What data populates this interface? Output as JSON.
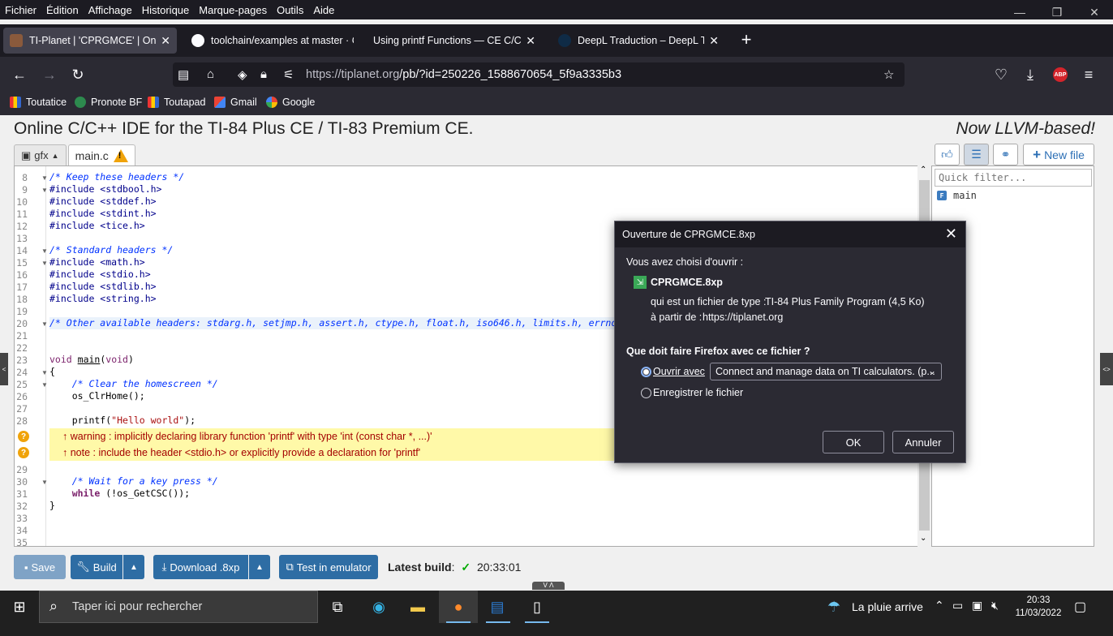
{
  "menu": [
    "Fichier",
    "Édition",
    "Affichage",
    "Historique",
    "Marque-pages",
    "Outils",
    "Aide"
  ],
  "window_controls": {
    "minimize": "—",
    "restore": "❐",
    "close": "✕"
  },
  "tabs": [
    {
      "title": "TI-Planet | 'CPRGMCE' | Online ID",
      "icon": "tiplanet-icon",
      "active": true
    },
    {
      "title": "toolchain/examples at master · C",
      "icon": "github-icon",
      "active": false
    },
    {
      "title": "Using printf Functions — CE C/C++",
      "icon": "",
      "active": false
    },
    {
      "title": "DeepL Traduction – DeepL Transl",
      "icon": "deepl-icon",
      "active": false
    }
  ],
  "new_tab": "+",
  "url": {
    "host": "https://tiplanet.org",
    "path": "/pb/?id=250226_1588670654_5f9a3335b3"
  },
  "bookmarks": [
    {
      "label": "Toutatice",
      "icon": "toutatice-icon"
    },
    {
      "label": "Pronote BF",
      "icon": "pronote-icon"
    },
    {
      "label": "Toutapad",
      "icon": "toutapad-icon"
    },
    {
      "label": "Gmail",
      "icon": "gmail-icon"
    },
    {
      "label": "Google",
      "icon": "google-icon"
    }
  ],
  "abp_badge": "ABP",
  "page": {
    "title": "Online C/C++ IDE for the TI-84 Plus CE / TI-83 Premium CE.",
    "tagline": "Now LLVM-based!",
    "gfx_tab": "gfx",
    "file_tab": "main.c",
    "new_file": "New file",
    "quick_filter_placeholder": "Quick filter...",
    "side_file": "main",
    "side_file_badge": "F"
  },
  "code": {
    "lines": [
      {
        "n": "8",
        "fold": true,
        "text": "/* Keep these headers */",
        "cls": "cmt"
      },
      {
        "n": "9",
        "fold": true,
        "text": "#include <stdbool.h>",
        "cls": "pp"
      },
      {
        "n": "10",
        "text": "#include <stddef.h>",
        "cls": "pp"
      },
      {
        "n": "11",
        "text": "#include <stdint.h>",
        "cls": "pp"
      },
      {
        "n": "12",
        "text": "#include <tice.h>",
        "cls": "pp"
      },
      {
        "n": "13",
        "text": "",
        "cls": ""
      },
      {
        "n": "14",
        "fold": true,
        "text": "/* Standard headers */",
        "cls": "cmt"
      },
      {
        "n": "15",
        "fold": true,
        "text": "#include <math.h>",
        "cls": "pp"
      },
      {
        "n": "16",
        "text": "#include <stdio.h>",
        "cls": "pp"
      },
      {
        "n": "17",
        "text": "#include <stdlib.h>",
        "cls": "pp"
      },
      {
        "n": "18",
        "text": "#include <string.h>",
        "cls": "pp"
      },
      {
        "n": "19",
        "text": "",
        "cls": ""
      },
      {
        "n": "20",
        "fold": true,
        "text": "/* Other available headers: stdarg.h, setjmp.h, assert.h, ctype.h, float.h, iso646.h, limits.h, errno.h */",
        "cls": "cmt",
        "hl": true
      },
      {
        "n": "21",
        "text": "",
        "cls": ""
      },
      {
        "n": "22",
        "text": "",
        "cls": ""
      },
      {
        "n": "23",
        "text": "void main(void)",
        "cls": "sig"
      },
      {
        "n": "24",
        "fold": true,
        "text": "{",
        "cls": ""
      },
      {
        "n": "25",
        "fold": true,
        "text": "    /* Clear the homescreen */",
        "cls": "cmt"
      },
      {
        "n": "26",
        "text": "    os_ClrHome();",
        "cls": ""
      },
      {
        "n": "27",
        "text": "",
        "cls": ""
      },
      {
        "n": "28",
        "text": "    printf(\"Hello world\");",
        "cls": "printf"
      }
    ],
    "diagnostics": [
      "↑ warning : implicitly declaring library function 'printf' with type 'int (const char *, ...)'",
      "↑ note : include the header <stdio.h> or explicitly provide a declaration for 'printf'"
    ],
    "diag_icon": "?",
    "lines_after": [
      {
        "n": "29",
        "text": "",
        "cls": ""
      },
      {
        "n": "30",
        "fold": true,
        "text": "    /* Wait for a key press */",
        "cls": "cmt"
      },
      {
        "n": "31",
        "text": "    while (!os_GetCSC());",
        "cls": "while"
      },
      {
        "n": "32",
        "text": "}",
        "cls": ""
      },
      {
        "n": "33",
        "text": "",
        "cls": ""
      },
      {
        "n": "34",
        "text": "",
        "cls": ""
      },
      {
        "n": "35",
        "text": "",
        "cls": ""
      }
    ]
  },
  "toolbar": {
    "save": "Save",
    "build": "Build",
    "download": "Download .8xp",
    "test": "Test in emulator",
    "latest_label": "Latest build",
    "latest_sep": ":",
    "latest_check": "✓",
    "latest_time": "20:33:01"
  },
  "dialog": {
    "title": "Ouverture de CPRGMCE.8xp",
    "intro": "Vous avez choisi d'ouvrir :",
    "filename": "CPRGMCE.8xp",
    "type_label": "qui est un fichier de type :",
    "type_value": "TI-84 Plus Family Program (4,5 Ko)",
    "from_label": "à partir de :",
    "from_value": "https://tiplanet.org",
    "question": "Que doit faire Firefox avec ce fichier ?",
    "open_with": "Ouvrir avec",
    "open_with_app": "Connect and manage data on TI calculators. (p...",
    "save_file": "Enregistrer le fichier",
    "ok": "OK",
    "cancel": "Annuler"
  },
  "taskbar": {
    "search_placeholder": "Taper ici pour rechercher",
    "weather": "La pluie arrive",
    "time": "20:33",
    "date": "11/03/2022"
  },
  "side_tabs": {
    "left": "<",
    "right": "<>",
    "bottom": "V Λ"
  }
}
